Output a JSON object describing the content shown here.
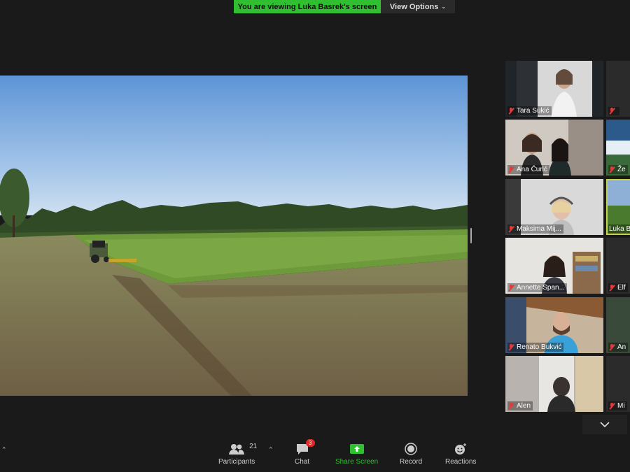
{
  "banner": {
    "viewing_text": "You are viewing Luka Basrek's screen",
    "view_options": "View Options"
  },
  "gallery": {
    "participants": [
      {
        "name": "Tara Sukić"
      },
      {
        "name": "Ana Ćurić"
      },
      {
        "name": "Maksima Mij..."
      },
      {
        "name": "Annette Span..."
      },
      {
        "name": "Renato Bukvić"
      },
      {
        "name": "Alen"
      }
    ],
    "right_column": [
      {
        "name": ""
      },
      {
        "name": "Že"
      },
      {
        "name": "Luka B"
      },
      {
        "name": "Elf"
      },
      {
        "name": "An"
      },
      {
        "name": "Mi"
      }
    ]
  },
  "toolbar": {
    "participants_label": "Participants",
    "participants_count": "21",
    "chat_label": "Chat",
    "chat_badge": "3",
    "share_label": "Share Screen",
    "record_label": "Record",
    "reactions_label": "Reactions"
  },
  "colors": {
    "accent_green": "#2fbf30",
    "muted_red": "#e23b3b",
    "active_speaker": "#c7d34f"
  }
}
